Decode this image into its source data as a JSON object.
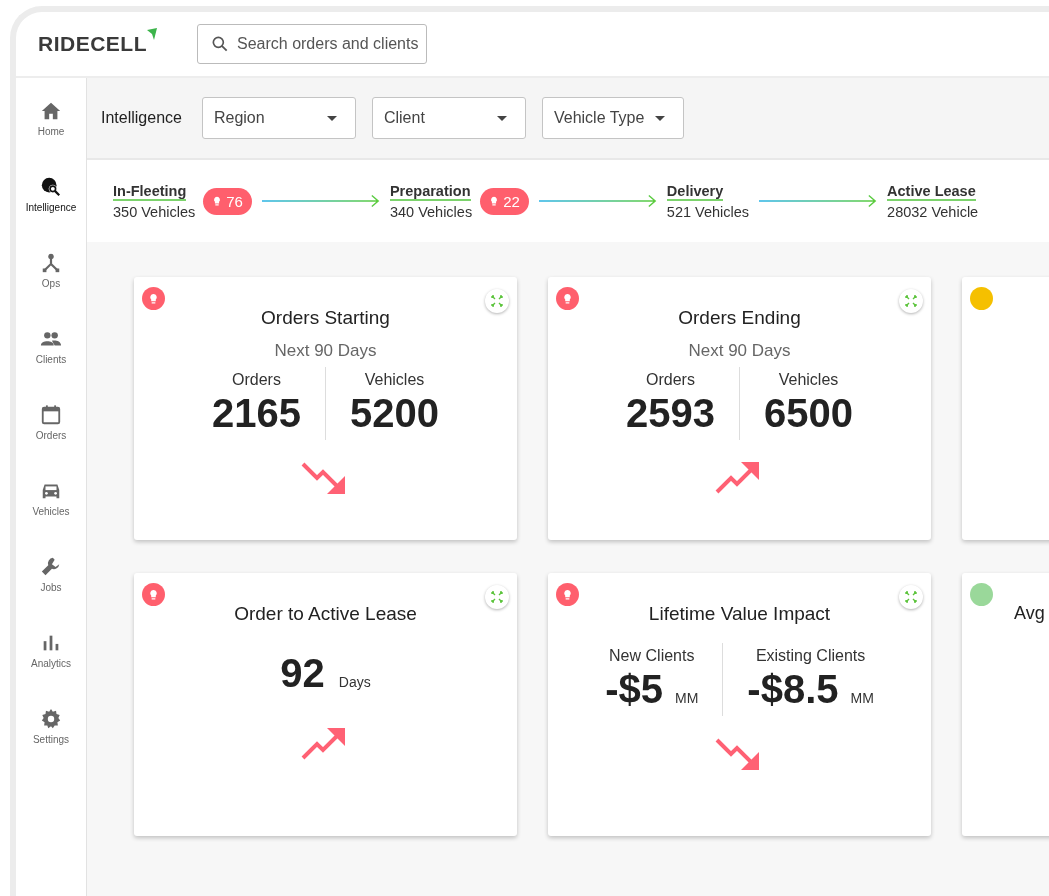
{
  "logo": "RIDECELL",
  "search": {
    "placeholder": "Search orders and clients"
  },
  "sidebar": {
    "items": [
      {
        "label": "Home",
        "kind": "home",
        "selected": false
      },
      {
        "label": "Intelligence",
        "kind": "globe",
        "selected": true
      },
      {
        "label": "Ops",
        "kind": "ops",
        "selected": false
      },
      {
        "label": "Clients",
        "kind": "people",
        "selected": false
      },
      {
        "label": "Orders",
        "kind": "calendar",
        "selected": false
      },
      {
        "label": "Vehicles",
        "kind": "car",
        "selected": false
      },
      {
        "label": "Jobs",
        "kind": "wrench",
        "selected": false
      },
      {
        "label": "Analytics",
        "kind": "bars",
        "selected": false
      },
      {
        "label": "Settings",
        "kind": "gear",
        "selected": false
      }
    ]
  },
  "filters": {
    "label": "Intelligence",
    "dropdowns": [
      "Region",
      "Client",
      "Vehicle Type"
    ]
  },
  "pipeline": [
    {
      "title": "In-Fleeting",
      "count": "350 Vehicles",
      "badge": "76"
    },
    {
      "title": "Preparation",
      "count": "340 Vehicles",
      "badge": "22"
    },
    {
      "title": "Delivery",
      "count": "521 Vehicles"
    },
    {
      "title": "Active Lease",
      "count": "28032 Vehicle"
    }
  ],
  "cards": [
    {
      "kind": "split",
      "indicator": {
        "kind": "bulb",
        "color": "#ff5f6d"
      },
      "title": "Orders Starting",
      "subtitle": "Next 90 Days",
      "metrics": [
        {
          "label": "Orders",
          "value": "2165"
        },
        {
          "label": "Vehicles",
          "value": "5200"
        }
      ],
      "trend": {
        "kind": "down"
      }
    },
    {
      "kind": "split",
      "indicator": {
        "kind": "bulb",
        "color": "#ff5f6d"
      },
      "title": "Orders Ending",
      "subtitle": "Next 90 Days",
      "metrics": [
        {
          "label": "Orders",
          "value": "2593"
        },
        {
          "label": "Vehicles",
          "value": "6500"
        }
      ],
      "trend": {
        "kind": "up"
      }
    },
    {
      "kind": "partial",
      "indicator": {
        "kind": "dot",
        "color": "#f5c000"
      }
    },
    {
      "kind": "single",
      "indicator": {
        "kind": "bulb",
        "color": "#ff5f6d"
      },
      "title": "Order to Active Lease",
      "value": "92",
      "unit": "Days",
      "trend": {
        "kind": "up"
      }
    },
    {
      "kind": "split",
      "indicator": {
        "kind": "bulb",
        "color": "#ff5f6d"
      },
      "title": "Lifetime Value Impact",
      "metrics": [
        {
          "label": "New Clients",
          "value": "-$5",
          "unit": "MM"
        },
        {
          "label": "Existing Clients",
          "value": "-$8.5",
          "unit": "MM"
        }
      ],
      "trend": {
        "kind": "down"
      }
    },
    {
      "kind": "partial",
      "indicator": {
        "kind": "dot",
        "color": "#9ad89a"
      },
      "title": "Avg"
    }
  ]
}
